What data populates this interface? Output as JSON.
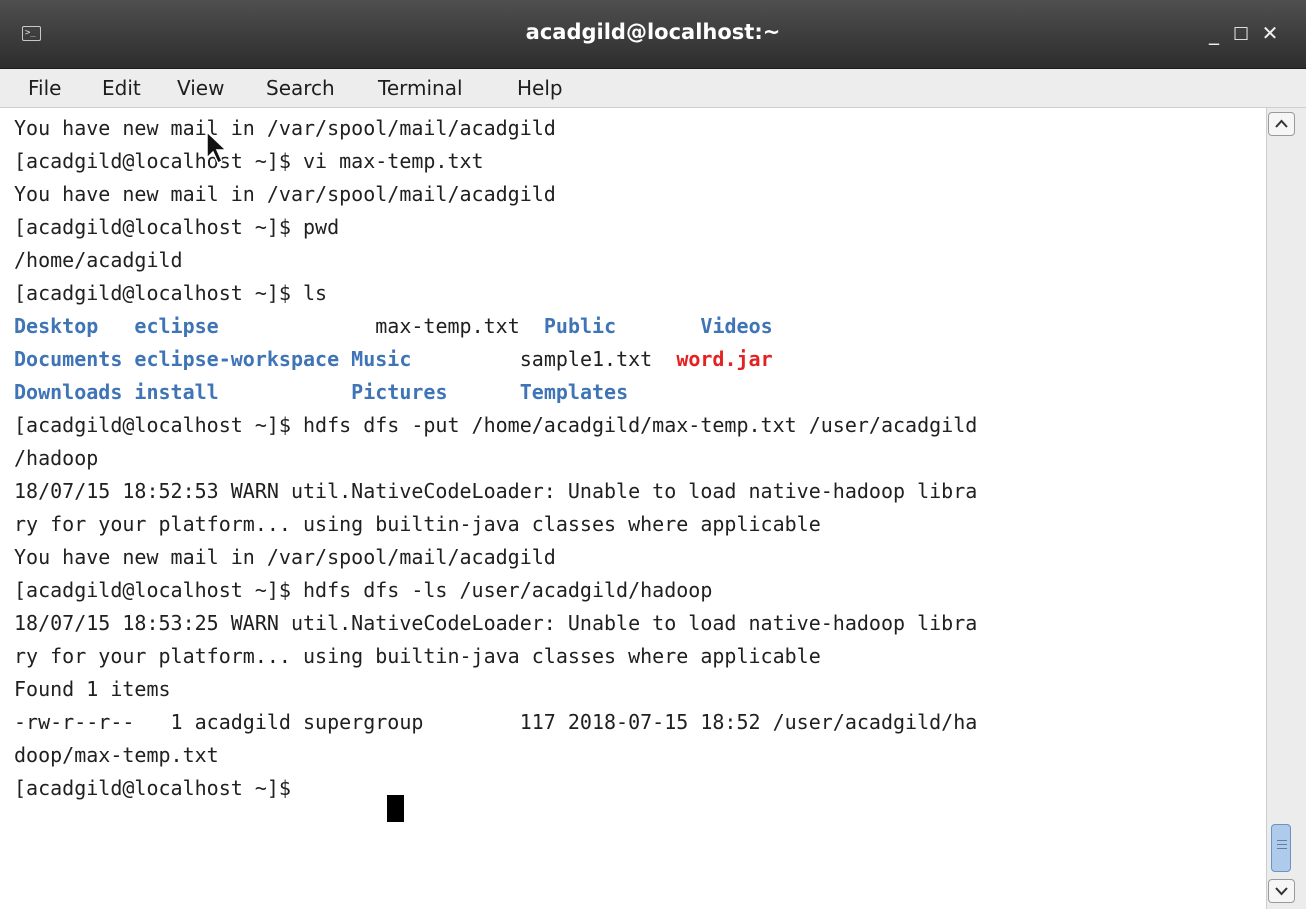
{
  "window": {
    "title": "acadgild@localhost:~",
    "controls": {
      "minimize": "_",
      "maximize": "□",
      "close": "✕"
    }
  },
  "menu": [
    "File",
    "Edit",
    "View",
    "Search",
    "Terminal",
    "Help"
  ],
  "terminal": {
    "lines": [
      "You have new mail in /var/spool/mail/acadgild",
      "[acadgild@localhost ~]$ vi max-temp.txt",
      "You have new mail in /var/spool/mail/acadgild",
      "[acadgild@localhost ~]$ pwd",
      "/home/acadgild",
      "[acadgild@localhost ~]$ ls",
      "[acadgild@localhost ~]$ hdfs dfs -put /home/acadgild/max-temp.txt /user/acadgild",
      "/hadoop",
      "18/07/15 18:52:53 WARN util.NativeCodeLoader: Unable to load native-hadoop libra",
      "ry for your platform... using builtin-java classes where applicable",
      "You have new mail in /var/spool/mail/acadgild",
      "[acadgild@localhost ~]$ hdfs dfs -ls /user/acadgild/hadoop",
      "18/07/15 18:53:25 WARN util.NativeCodeLoader: Unable to load native-hadoop libra",
      "ry for your platform... using builtin-java classes where applicable",
      "Found 1 items",
      "-rw-r--r--   1 acadgild supergroup        117 2018-07-15 18:52 /user/acadgild/ha",
      "doop/max-temp.txt",
      "[acadgild@localhost ~]$ "
    ],
    "ls_rows": [
      [
        "Desktop",
        "eclipse",
        "max-temp.txt",
        "Public",
        "Videos"
      ],
      [
        "Documents",
        "eclipse-workspace",
        "Music",
        "sample1.txt",
        "word.jar"
      ],
      [
        "Downloads",
        "install",
        "Pictures",
        "Templates",
        ""
      ]
    ]
  },
  "colors": {
    "directory": "#3f74b6",
    "archive": "#e42222",
    "text": "#202020",
    "titlebar": "#3a3a3a"
  }
}
